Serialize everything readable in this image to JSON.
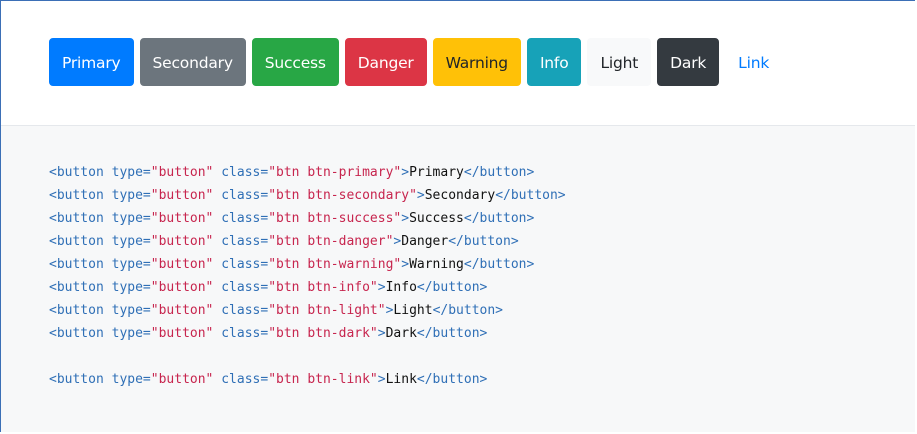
{
  "buttons": [
    {
      "label": "Primary"
    },
    {
      "label": "Secondary"
    },
    {
      "label": "Success"
    },
    {
      "label": "Danger"
    },
    {
      "label": "Warning"
    },
    {
      "label": "Info"
    },
    {
      "label": "Light"
    },
    {
      "label": "Dark"
    },
    {
      "label": "Link"
    }
  ],
  "code": {
    "open": "<button",
    "type_attr": " type=",
    "type_val": "\"button\"",
    "class_attr": " class=",
    "close_bracket": ">",
    "end_tag": "</button>",
    "lines": [
      {
        "class_val": "\"btn btn-primary\"",
        "text": "Primary"
      },
      {
        "class_val": "\"btn btn-secondary\"",
        "text": "Secondary"
      },
      {
        "class_val": "\"btn btn-success\"",
        "text": "Success"
      },
      {
        "class_val": "\"btn btn-danger\"",
        "text": "Danger"
      },
      {
        "class_val": "\"btn btn-warning\"",
        "text": "Warning"
      },
      {
        "class_val": "\"btn btn-info\"",
        "text": "Info"
      },
      {
        "class_val": "\"btn btn-light\"",
        "text": "Light"
      },
      {
        "class_val": "\"btn btn-dark\"",
        "text": "Dark"
      }
    ],
    "link_line": {
      "class_val": "\"btn btn-link\"",
      "text": "Link"
    }
  },
  "colors": {
    "primary": "#007bff",
    "secondary": "#6c757d",
    "success": "#28a745",
    "danger": "#dc3545",
    "warning": "#ffc107",
    "info": "#17a2b8",
    "light": "#f8f9fa",
    "dark": "#343a40",
    "code_tag": "#2f6fb6",
    "code_string": "#c7254e"
  }
}
